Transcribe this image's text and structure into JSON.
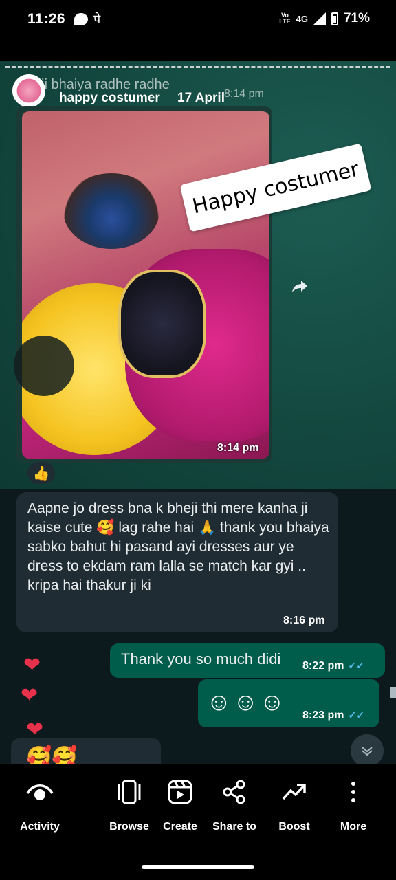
{
  "status_bar": {
    "time": "11:26",
    "paytm_glyph": "पे",
    "network": "4G",
    "volte_line1": "Vo",
    "volte_line2": "LTE",
    "battery": "71%"
  },
  "story": {
    "ghost_text": "ji bhaiya radhe radhe",
    "ghost_time": "8:14 pm",
    "header_name": "happy costumer",
    "header_date": "17 April",
    "sticker_text": "Happy costumer",
    "photo_time": "8:14 pm",
    "incoming": {
      "text": "Aapne jo dress bna k bheji thi mere kanha ji kaise cute 🥰 lag rahe hai 🙏 thank you bhaiya sabko bahut hi pasand ayi dresses aur ye dress to ekdam ram lalla se match kar gyi .. kripa hai thakur ji ki",
      "time": "8:16 pm"
    },
    "outgoing": [
      {
        "text": "Thank you so much didi",
        "time": "8:22 pm"
      },
      {
        "text": "☺☺☺",
        "time": "8:23 pm"
      }
    ],
    "reactions": [
      "❤",
      "❤",
      "❤"
    ],
    "partial_emoji": "🥰🥰",
    "like_reaction": "👍"
  },
  "bottom_nav": [
    {
      "label": "Activity",
      "icon": "eye-icon"
    },
    {
      "label": "Browse",
      "icon": "carousel-icon"
    },
    {
      "label": "Create",
      "icon": "reel-icon"
    },
    {
      "label": "Share to",
      "icon": "share-icon"
    },
    {
      "label": "Boost",
      "icon": "trend-up-icon"
    },
    {
      "label": "More",
      "icon": "more-vertical-icon"
    }
  ]
}
